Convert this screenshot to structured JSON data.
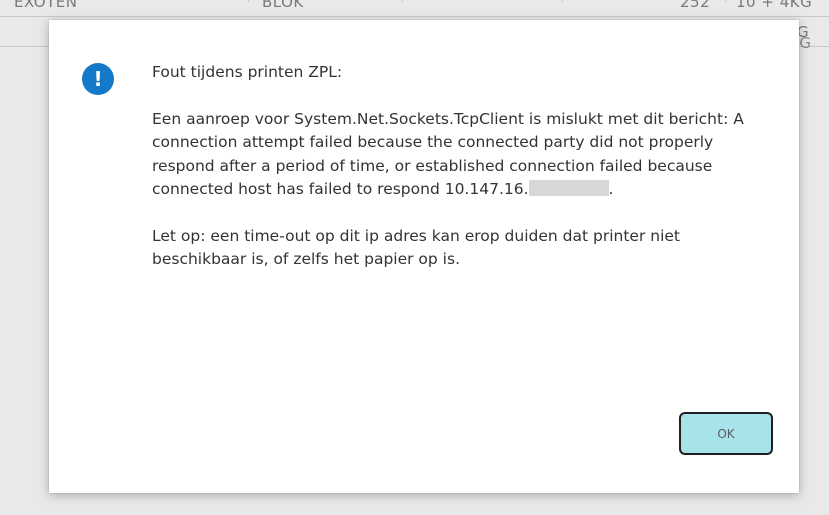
{
  "background": {
    "row1": {
      "col1": "EXOTEN",
      "col2": "BLOK",
      "col3": "252",
      "col4": "10 + 4KG"
    },
    "row2": {
      "col4": "G"
    },
    "side": "G"
  },
  "dialog": {
    "icon": "info-icon",
    "icon_glyph": "!",
    "title": "Fout tijdens printen ZPL:",
    "body_text": "Een aanroep voor System.Net.Sockets.TcpClient is mislukt met dit bericht: A connection attempt failed because the connected party did not properly respond after a period of time, or established connection failed because connected host has failed to respond 10.147.16.",
    "body_suffix": ".",
    "note": "Let op: een time-out op dit ip adres kan erop duiden dat printer niet beschikbaar is, of zelfs het papier op is.",
    "ok_label": "OK"
  },
  "colors": {
    "icon": "#1479c8",
    "ok_button": "#a8e3ea",
    "dialog_bg": "#ffffff",
    "backdrop": "#e9e9e9"
  }
}
